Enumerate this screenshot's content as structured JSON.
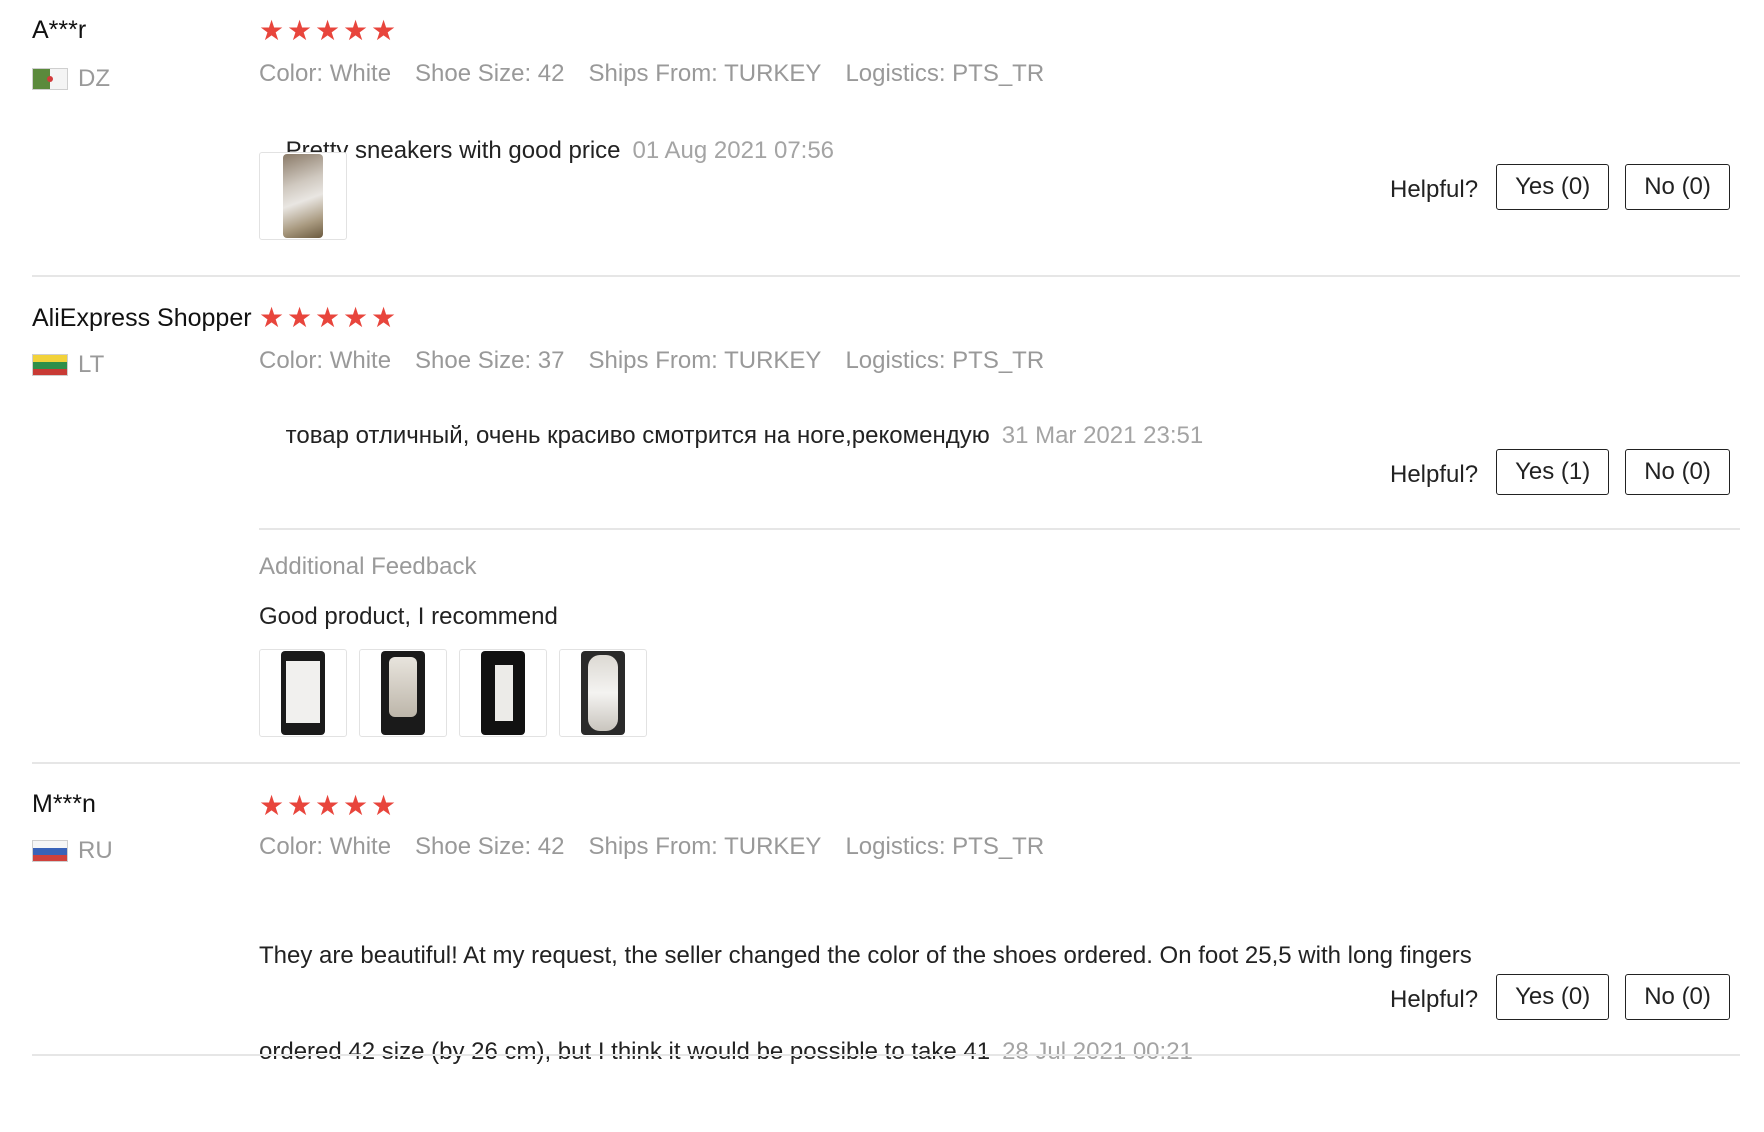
{
  "helpful_label": "Helpful?",
  "reviews": [
    {
      "user": "A***r",
      "country": "DZ",
      "stars": [
        "★",
        "★",
        "★",
        "★",
        "★"
      ],
      "color": "Color: White",
      "size": "Shoe Size: 42",
      "ships": "Ships From: TURKEY",
      "logistics": "Logistics: PTS_TR",
      "text": "Pretty sneakers with good price",
      "date": "01 Aug 2021 07:56",
      "yes": "Yes (0)",
      "no": "No (0)"
    },
    {
      "user": "AliExpress Shopper",
      "country": "LT",
      "stars": [
        "★",
        "★",
        "★",
        "★",
        "★"
      ],
      "color": "Color: White",
      "size": "Shoe Size: 37",
      "ships": "Ships From: TURKEY",
      "logistics": "Logistics: PTS_TR",
      "text": "товар отличный, очень красиво смотрится на ноге,рекомендую",
      "date": "31 Mar 2021 23:51",
      "yes": "Yes (1)",
      "no": "No (0)",
      "additional_title": "Additional Feedback",
      "additional_text": "Good product, I recommend"
    },
    {
      "user": "M***n",
      "country": "RU",
      "stars": [
        "★",
        "★",
        "★",
        "★",
        "★"
      ],
      "color": "Color: White",
      "size": "Shoe Size: 42",
      "ships": "Ships From: TURKEY",
      "logistics": "Logistics: PTS_TR",
      "text_line1": "They are beautiful! At my request, the seller changed the color of the shoes ordered. On foot 25,5 with long fingers",
      "text_line2": "ordered 42 size (by 26 cm), but I think it would be possible to take 41",
      "date": "28 Jul 2021 00:21",
      "yes": "Yes (0)",
      "no": "No (0)"
    }
  ]
}
